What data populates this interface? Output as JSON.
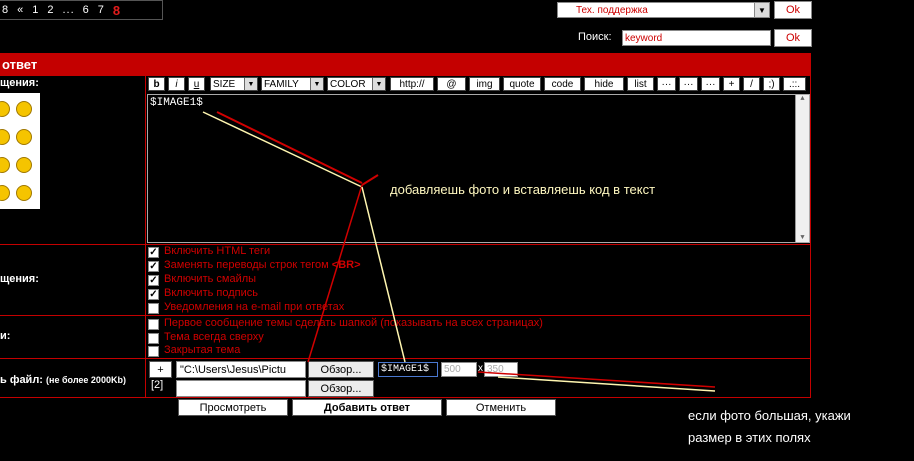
{
  "pager": {
    "items": [
      "8",
      "«",
      "1",
      "2",
      "...",
      "6",
      "7"
    ],
    "current": "8"
  },
  "support": {
    "select_value": "Тех. поддержка",
    "ok": "Ok"
  },
  "search": {
    "label": "Поиск:",
    "value": "keyword",
    "ok": "Ok"
  },
  "form": {
    "header": "ответ",
    "smiles_label": "щения:",
    "options_label": "щения:",
    "topic_label": "и:",
    "file_label": "ь файл:",
    "file_limit": "(не более 2000Kb)"
  },
  "toolbar": {
    "bold": "b",
    "italic": "i",
    "underline": "u",
    "size": "SIZE",
    "family": "FAMILY",
    "color": "COLOR",
    "http": "http://",
    "at": "@",
    "img": "img",
    "quote": "quote",
    "code": "code",
    "hide": "hide",
    "list": "list",
    "dots1": "···",
    "dots2": "···",
    "dots3": "···",
    "plus": "+",
    "slash": "/",
    "smile": ";)",
    "more": ".::."
  },
  "editor": {
    "content": "$IMAGE1$"
  },
  "annotations": {
    "note1": "добавляешь фото и вставляешь код в текст",
    "note2_line1": "если фото большая, укажи",
    "note2_line2": "размер в этих полях"
  },
  "options": [
    {
      "label": "Включить HTML теги",
      "checked": true
    },
    {
      "label_pre": "Заменять переводы строк тегом ",
      "label_tag": "<BR>",
      "checked": true
    },
    {
      "label": "Включить смайлы",
      "checked": true
    },
    {
      "label": "Включить подпись",
      "checked": true
    },
    {
      "label": "Уведомления на e-mail при ответах",
      "checked": false
    }
  ],
  "topic_options": [
    {
      "label": "Первое сообщение темы сделать шапкой (показывать на всех страницах)",
      "checked": false
    },
    {
      "label": "Тема всегда сверху",
      "checked": false
    },
    {
      "label": "Закрытая тема",
      "checked": false
    }
  ],
  "attach": {
    "plus": "+",
    "index": "[2]",
    "path": "\"C:\\Users\\Jesus\\Pictu",
    "path2": "",
    "browse1": "Обзор...",
    "browse2": "Обзор...",
    "code": "$IMAGE1$",
    "width": "500",
    "times": "x",
    "height": "350"
  },
  "actions": {
    "preview": "Просмотреть",
    "submit": "Добавить ответ",
    "cancel": "Отменить"
  }
}
